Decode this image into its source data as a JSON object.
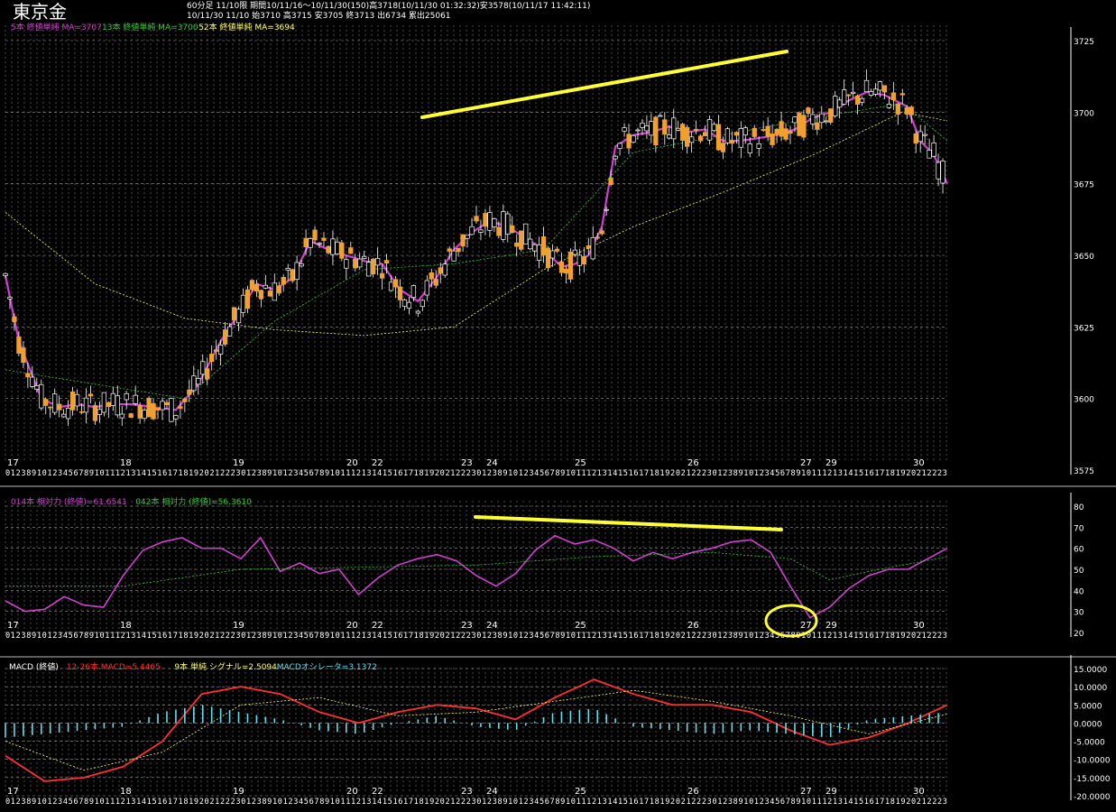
{
  "header": {
    "symbol": "東京金",
    "line1": "60分足 11/10限 期間10/11/16〜10/11/30(150)高3718(10/11/30 01:32:32)安3578(10/11/17 11:42:11)",
    "line2": "10/11/30 11/10 始3710 高3715 安3705 終3713 出6734 累出25061"
  },
  "price_panel": {
    "legend": [
      {
        "text": "5本 終値単純 MA=3707",
        "color": "#d040d0"
      },
      {
        "text": "13本 終値単純 MA=3700",
        "color": "#33cc33"
      },
      {
        "text": "52本 終値単純 MA=3694",
        "color": "#ffff66"
      }
    ],
    "y_ticks": [
      "3725",
      "3700",
      "3675",
      "3650",
      "3625",
      "3600",
      "3575"
    ],
    "day_labels": [
      "17",
      "18",
      "19",
      "20",
      "22",
      "23",
      "24",
      "25",
      "26",
      "27",
      "29",
      "30"
    ]
  },
  "rsi_panel": {
    "legend": [
      {
        "text": "014本 相対力 (終値)=61.6541",
        "color": "#d040d0"
      },
      {
        "text": "042本 相対力 (終値)=56.3610",
        "color": "#33cc33"
      }
    ],
    "y_ticks": [
      "80",
      "70",
      "60",
      "50",
      "40",
      "30",
      "20"
    ],
    "day_labels": [
      "17",
      "18",
      "19",
      "20",
      "22",
      "23",
      "24",
      "25",
      "26",
      "27",
      "29",
      "30"
    ]
  },
  "macd_panel": {
    "legend": [
      {
        "text": "MACD (終値)",
        "color": "#ffffff"
      },
      {
        "text": "12-26本 MACD=5.4465",
        "color": "#ff3030"
      },
      {
        "text": "9本 単純 シグナル=2.5094",
        "color": "#ffff66"
      },
      {
        "text": "MACDオシレータ=3.1372",
        "color": "#66ddee"
      }
    ],
    "y_ticks": [
      "15.0000",
      "10.0000",
      "5.0000",
      "0.0000",
      "-5.0000",
      "-10.0000",
      "-15.0000",
      "-20.0000"
    ],
    "day_labels": [
      "17",
      "18",
      "19",
      "20",
      "22",
      "23",
      "24",
      "25",
      "26",
      "27",
      "29",
      "30"
    ]
  },
  "time_axis_digits": "012389101234567891011121314151617181920212223",
  "colors": {
    "background": "#000000",
    "grid": "#9a9a9a",
    "candle_up": "#000000",
    "candle_down": "#f0a030",
    "ma5": "#d040d0",
    "ma13": "#33cc33",
    "ma52": "#ffff66",
    "rsi14": "#d040d0",
    "rsi42": "#33cc33",
    "macd": "#ff3030",
    "signal": "#ffff66",
    "osc": "#66ddee",
    "annotation": "#ffff33"
  },
  "chart_data": [
    {
      "type": "candlestick",
      "ylim": [
        3575,
        3730
      ],
      "series": [
        {
          "name": "5本 終値単純 MA",
          "x": [
            0,
            3,
            8,
            12,
            16,
            20,
            24,
            28,
            33,
            38,
            43,
            48,
            53,
            56,
            60,
            64,
            68,
            72,
            76,
            80,
            84,
            88,
            92,
            96,
            100,
            104,
            108,
            112,
            116,
            120,
            124,
            127,
            130,
            133,
            136,
            140,
            144,
            148,
            152,
            156,
            160,
            164,
            168,
            172,
            176,
            180,
            184,
            188,
            192,
            196,
            201,
            204,
            207,
            210
          ],
          "values": [
            3643,
            3620,
            3600,
            3597,
            3598,
            3597,
            3598,
            3598,
            3597,
            3596,
            3605,
            3620,
            3632,
            3640,
            3638,
            3642,
            3655,
            3652,
            3650,
            3648,
            3647,
            3638,
            3634,
            3642,
            3652,
            3658,
            3662,
            3660,
            3656,
            3652,
            3646,
            3647,
            3650,
            3660,
            3688,
            3692,
            3693,
            3695,
            3693,
            3694,
            3690,
            3690,
            3691,
            3692,
            3694,
            3698,
            3700,
            3704,
            3707,
            3706,
            3702,
            3690,
            3685,
            3675
          ]
        },
        {
          "name": "13本 終値単純 MA",
          "x": [
            0,
            20,
            40,
            60,
            80,
            100,
            120,
            140,
            160,
            180,
            200,
            210
          ],
          "values": [
            3610,
            3605,
            3600,
            3627,
            3645,
            3647,
            3652,
            3686,
            3692,
            3698,
            3703,
            3690
          ]
        },
        {
          "name": "52本 終値単純 MA",
          "x": [
            0,
            20,
            40,
            60,
            80,
            100,
            120,
            140,
            160,
            180,
            200,
            210
          ],
          "values": [
            3665,
            3640,
            3628,
            3624,
            3622,
            3625,
            3645,
            3660,
            3672,
            3685,
            3700,
            3697
          ]
        }
      ]
    },
    {
      "type": "line",
      "ylim": [
        20,
        80
      ],
      "series": [
        {
          "name": "014本 相対力 (終値)",
          "x": [
            0,
            5,
            10,
            15,
            20,
            25,
            30,
            35,
            40,
            45,
            50,
            55,
            60,
            65,
            70,
            75,
            80,
            85,
            90,
            95,
            100,
            105,
            110,
            115,
            120,
            125,
            130,
            135,
            140,
            145,
            150,
            155,
            160,
            165,
            170,
            175,
            180,
            185,
            190,
            195,
            200,
            205,
            210,
            215,
            220,
            225,
            230,
            235,
            240
          ],
          "values": [
            35,
            30,
            31,
            37,
            33,
            32,
            47,
            59,
            63,
            65,
            60,
            60,
            55,
            65,
            49,
            53,
            48,
            50,
            38,
            46,
            52,
            55,
            57,
            54,
            47,
            42,
            48,
            59,
            66,
            62,
            64,
            60,
            54,
            58,
            55,
            58,
            60,
            63,
            64,
            58,
            42,
            27,
            32,
            41,
            47,
            50,
            50,
            55,
            60
          ]
        },
        {
          "name": "042本 相対力 (終値)",
          "x": [
            0,
            30,
            60,
            90,
            120,
            150,
            180,
            200,
            210,
            220,
            240
          ],
          "values": [
            42,
            42,
            50,
            51,
            52,
            56,
            58,
            55,
            45,
            49,
            56
          ]
        }
      ]
    },
    {
      "type": "line",
      "ylim": [
        -20,
        15
      ],
      "series": [
        {
          "name": "12-26本 MACD",
          "x": [
            0,
            10,
            20,
            30,
            40,
            50,
            60,
            70,
            80,
            90,
            100,
            110,
            120,
            130,
            140,
            150,
            160,
            170,
            180,
            190,
            200,
            210,
            220,
            230,
            240
          ],
          "values": [
            -9,
            -16,
            -15,
            -12,
            -5,
            8,
            10,
            8,
            3,
            0,
            3,
            5,
            4,
            1,
            7,
            12,
            8,
            5,
            5,
            3,
            -2,
            -6,
            -4,
            0,
            5
          ]
        },
        {
          "name": "9本 単純 シグナル",
          "x": [
            0,
            20,
            40,
            60,
            80,
            100,
            120,
            140,
            160,
            180,
            200,
            220,
            240
          ],
          "values": [
            -5,
            -13,
            -8,
            5,
            7,
            2,
            3,
            6,
            9,
            6,
            2,
            -3,
            2.5
          ]
        },
        {
          "name": "MACDオシレータ",
          "x": [
            0,
            10,
            20,
            30,
            40,
            50,
            60,
            70,
            80,
            90,
            100,
            110,
            120,
            130,
            140,
            150,
            160,
            170,
            180,
            190,
            200,
            210,
            220,
            230,
            240
          ],
          "values": [
            -4,
            -3,
            -2,
            -1,
            3,
            5,
            3,
            1,
            -2,
            -3,
            0,
            2,
            -1,
            -2,
            3,
            4,
            -1,
            -2,
            -3,
            -2,
            -3,
            -4,
            1,
            2,
            3
          ]
        }
      ]
    }
  ]
}
